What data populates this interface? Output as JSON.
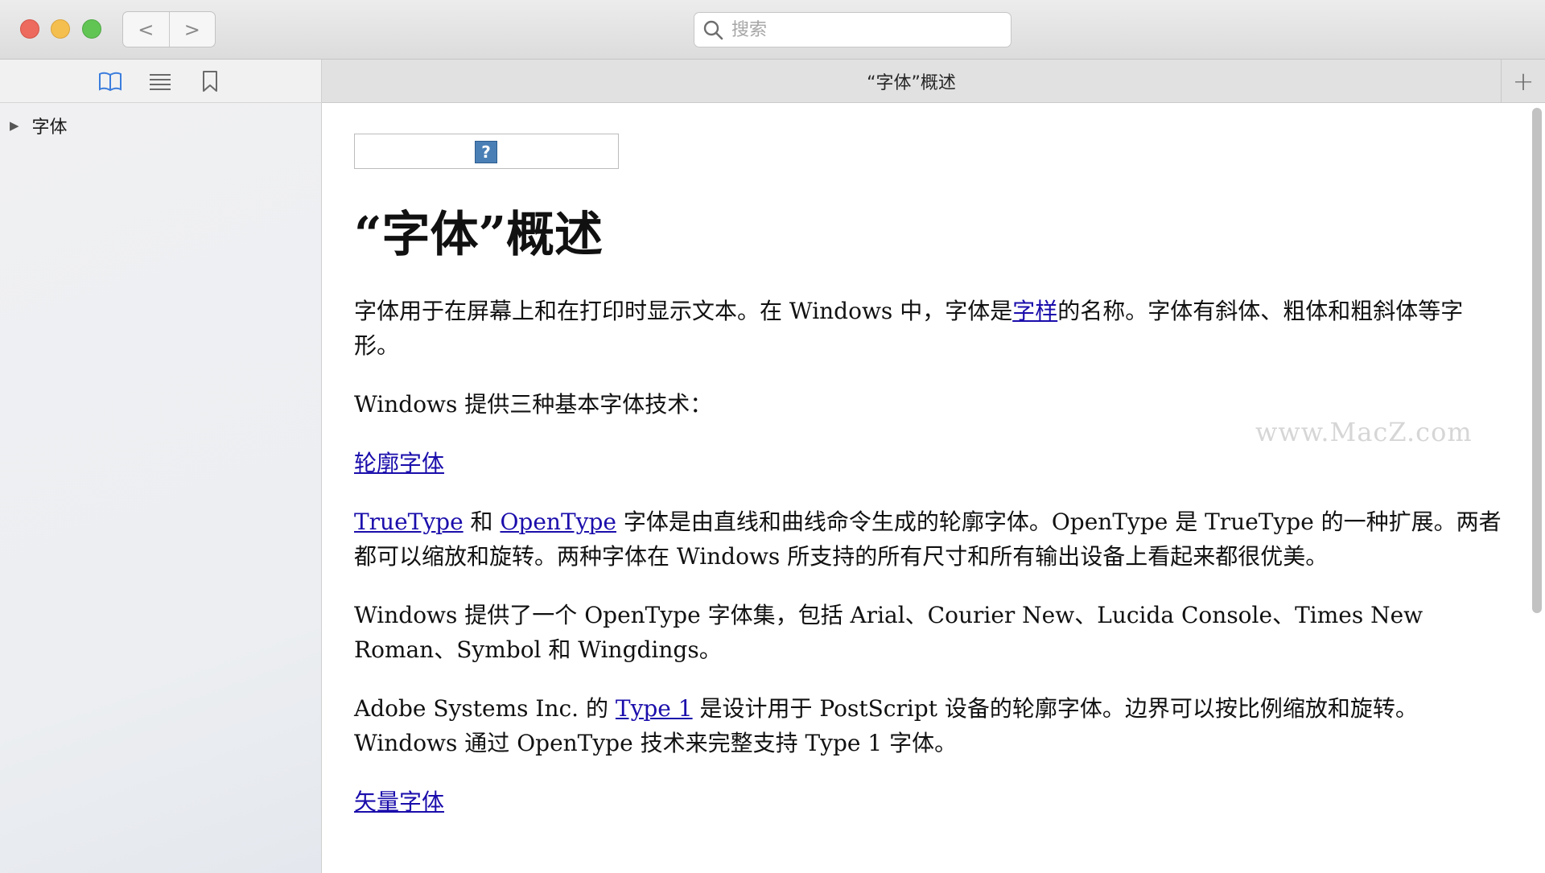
{
  "window": {
    "search_placeholder": "搜索"
  },
  "nav": {
    "back_glyph": "<",
    "forward_glyph": ">"
  },
  "sidebar": {
    "tools": [
      "book-icon",
      "list-icon",
      "bookmark-icon"
    ],
    "active_tool": "book-icon",
    "accent_color": "#3b7ddd",
    "items": [
      {
        "label": "字体",
        "expanded": false
      }
    ]
  },
  "tab": {
    "title": "“字体”概述",
    "new_tab_glyph": "+"
  },
  "article": {
    "heading": "“字体”概述",
    "p1": {
      "before": "字体用于在屏幕上和在打印时显示文本。在 Windows 中，字体是",
      "link": "字样",
      "after": "的名称。字体有斜体、粗体和粗斜体等字形。"
    },
    "p2": "Windows 提供三种基本字体技术：",
    "link_outline": "轮廓字体",
    "p3": {
      "link1": "TrueType",
      "mid1": " 和 ",
      "link2": "OpenType",
      "after": " 字体是由直线和曲线命令生成的轮廓字体。OpenType 是 TrueType 的一种扩展。两者都可以缩放和旋转。两种字体在 Windows 所支持的所有尺寸和所有输出设备上看起来都很优美。"
    },
    "p4": "Windows 提供了一个 OpenType 字体集，包括 Arial、Courier New、Lucida Console、Times New Roman、Symbol 和 Wingdings。",
    "p5": {
      "before": "Adobe Systems Inc. 的 ",
      "link": "Type 1",
      "after": " 是设计用于 PostScript 设备的轮廓字体。边界可以按比例缩放和旋转。Windows 通过 OpenType 技术来完整支持 Type 1 字体。"
    },
    "link_vector": "矢量字体",
    "placeholder_image_glyph": "?",
    "link_color": "#1a0dab"
  },
  "watermark": "www.MacZ.com"
}
